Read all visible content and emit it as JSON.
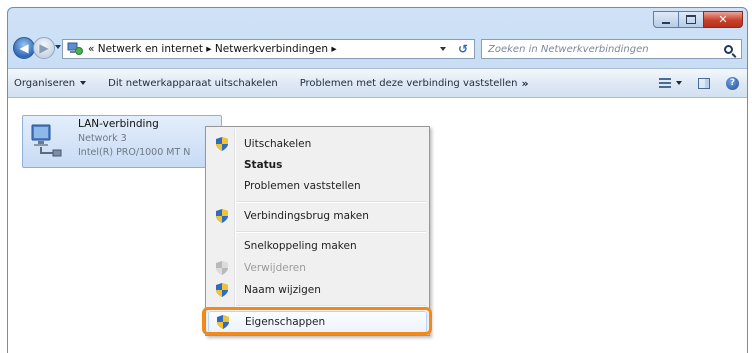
{
  "window": {
    "caption_buttons": [
      "minimize",
      "maximize",
      "close"
    ]
  },
  "nav": {
    "back_icon": "back-arrow-icon",
    "forward_icon": "forward-arrow-icon"
  },
  "address_bar": {
    "path_text": "« Netwerk en internet ▸ Netwerkverbindingen ▸",
    "refresh_symbol": "↺"
  },
  "search": {
    "placeholder": "Zoeken in Netwerkverbindingen"
  },
  "toolbar": {
    "organize_label": "Organiseren",
    "disable_label": "Dit netwerkapparaat uitschakelen",
    "diagnose_label": "Problemen met deze verbinding vaststellen",
    "more_chevron": "»",
    "help_symbol": "?"
  },
  "connection": {
    "name": "LAN-verbinding",
    "network": "Network 3",
    "adapter": "Intel(R) PRO/1000 MT N"
  },
  "context_menu": {
    "items": [
      {
        "label": "Uitschakelen",
        "shield": true,
        "bold": false,
        "disabled": false
      },
      {
        "label": "Status",
        "shield": false,
        "bold": true,
        "disabled": false
      },
      {
        "label": "Problemen vaststellen",
        "shield": false,
        "bold": false,
        "disabled": false
      },
      {
        "label": "Verbindingsbrug maken",
        "shield": true,
        "bold": false,
        "disabled": false
      },
      {
        "label": "Snelkoppeling maken",
        "shield": false,
        "bold": false,
        "disabled": false
      },
      {
        "label": "Verwijderen",
        "shield": true,
        "bold": false,
        "disabled": true
      },
      {
        "label": "Naam wijzigen",
        "shield": true,
        "bold": false,
        "disabled": false
      },
      {
        "label": "Eigenschappen",
        "shield": true,
        "bold": false,
        "disabled": false,
        "highlighted": true
      }
    ]
  },
  "colors": {
    "highlight_ring": "#f08a1c",
    "window_frame": "#b9d1ec"
  }
}
